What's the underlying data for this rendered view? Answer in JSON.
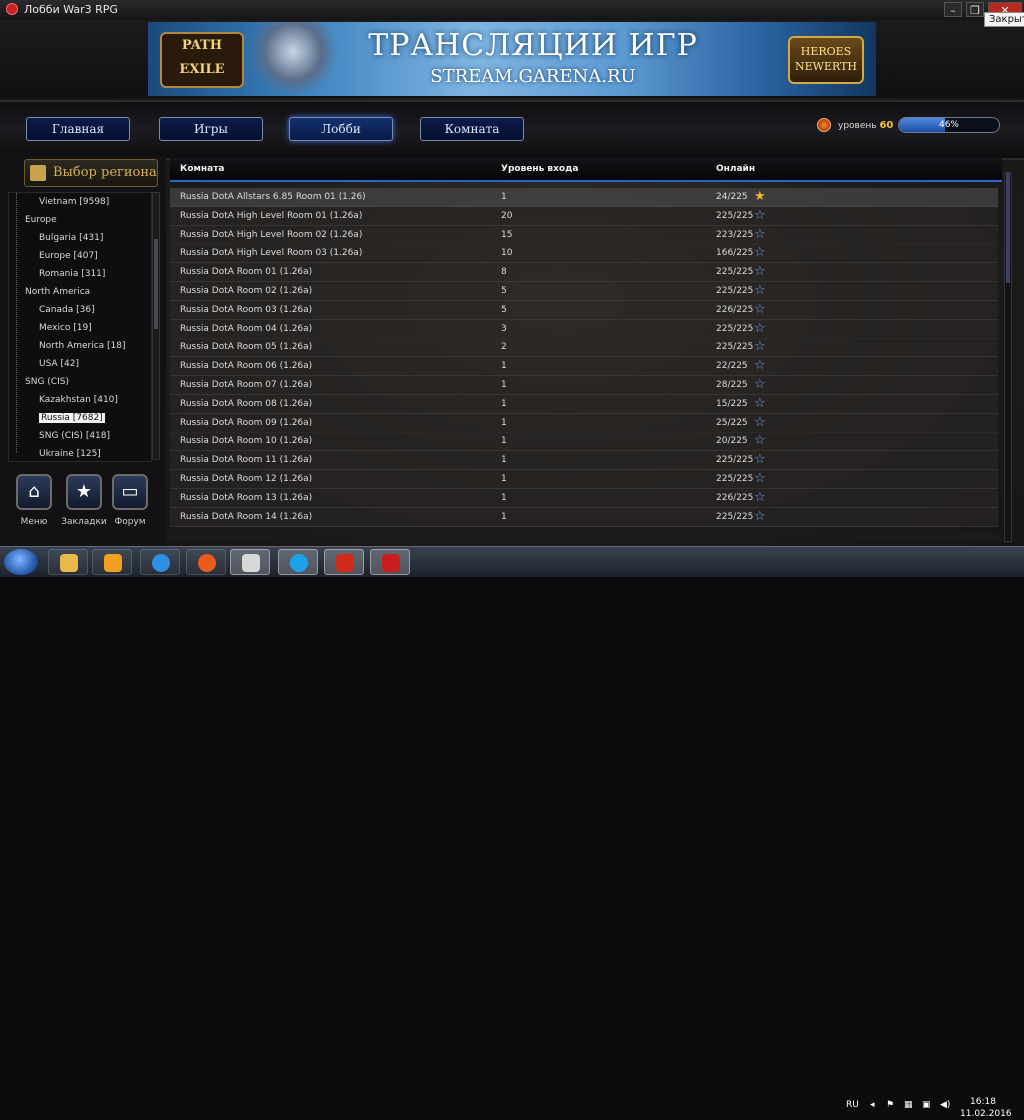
{
  "window": {
    "title": "Лобби War3 RPG",
    "close_tooltip": "Закрыть"
  },
  "banner": {
    "heading": "ТРАНСЛЯЦИИ ИГР",
    "subheading": "STREAM.GARENA.RU",
    "logo_left": "PATH OF EXILE",
    "logo_right": "HEROES OF NEWERTH"
  },
  "nav": {
    "tabs": [
      {
        "label": "Главная",
        "active": false
      },
      {
        "label": "Игры",
        "active": false
      },
      {
        "label": "Лобби",
        "active": true
      },
      {
        "label": "Комната",
        "active": false
      }
    ]
  },
  "level": {
    "label": "уровень",
    "value": "60",
    "progress_text": "46%",
    "progress": 46
  },
  "sidebar": {
    "region_title": "Выбор региона",
    "tree": [
      {
        "label": "Vietnam [9598]",
        "depth": 1,
        "selected": false
      },
      {
        "label": "Europe",
        "depth": 0,
        "selected": false
      },
      {
        "label": "Bulgaria [431]",
        "depth": 1,
        "selected": false
      },
      {
        "label": "Europe [407]",
        "depth": 1,
        "selected": false
      },
      {
        "label": "Romania [311]",
        "depth": 1,
        "selected": false
      },
      {
        "label": "North America",
        "depth": 0,
        "selected": false
      },
      {
        "label": "Canada [36]",
        "depth": 1,
        "selected": false
      },
      {
        "label": "Mexico [19]",
        "depth": 1,
        "selected": false
      },
      {
        "label": "North America [18]",
        "depth": 1,
        "selected": false
      },
      {
        "label": "USA [42]",
        "depth": 1,
        "selected": false
      },
      {
        "label": "SNG (CIS)",
        "depth": 0,
        "selected": false
      },
      {
        "label": "Kazakhstan [410]",
        "depth": 1,
        "selected": false
      },
      {
        "label": "Russia [7682]",
        "depth": 1,
        "selected": true
      },
      {
        "label": "SNG (CIS) [418]",
        "depth": 1,
        "selected": false
      },
      {
        "label": "Ukraine [125]",
        "depth": 1,
        "selected": false
      }
    ],
    "buttons": [
      {
        "label": "Меню",
        "icon": "home-icon"
      },
      {
        "label": "Закладки",
        "icon": "star-icon"
      },
      {
        "label": "Форум",
        "icon": "monitor-icon"
      }
    ]
  },
  "rooms": {
    "columns": [
      "Комната",
      "Уровень входа",
      "Онлайн"
    ],
    "rows": [
      {
        "name": "Russia DotA Allstars 6.85 Room 01 (1.26)",
        "level": "1",
        "online": "24/225",
        "favorite": true
      },
      {
        "name": "Russia DotA High Level Room 01 (1.26a)",
        "level": "20",
        "online": "225/225",
        "favorite": false
      },
      {
        "name": "Russia DotA High Level Room 02 (1.26a)",
        "level": "15",
        "online": "223/225",
        "favorite": false
      },
      {
        "name": "Russia DotA High Level Room 03 (1.26a)",
        "level": "10",
        "online": "166/225",
        "favorite": false
      },
      {
        "name": "Russia DotA Room 01 (1.26a)",
        "level": "8",
        "online": "225/225",
        "favorite": false
      },
      {
        "name": "Russia DotA Room 02 (1.26a)",
        "level": "5",
        "online": "225/225",
        "favorite": false
      },
      {
        "name": "Russia DotA Room 03 (1.26a)",
        "level": "5",
        "online": "226/225",
        "favorite": false
      },
      {
        "name": "Russia DotA Room 04 (1.26a)",
        "level": "3",
        "online": "225/225",
        "favorite": false
      },
      {
        "name": "Russia DotA Room 05 (1.26a)",
        "level": "2",
        "online": "225/225",
        "favorite": false
      },
      {
        "name": "Russia DotA Room 06 (1.26a)",
        "level": "1",
        "online": "22/225",
        "favorite": false
      },
      {
        "name": "Russia DotA Room 07 (1.26a)",
        "level": "1",
        "online": "28/225",
        "favorite": false
      },
      {
        "name": "Russia DotA Room 08 (1.26a)",
        "level": "1",
        "online": "15/225",
        "favorite": false
      },
      {
        "name": "Russia DotA Room 09 (1.26a)",
        "level": "1",
        "online": "25/225",
        "favorite": false
      },
      {
        "name": "Russia DotA Room 10 (1.26a)",
        "level": "1",
        "online": "20/225",
        "favorite": false
      },
      {
        "name": "Russia DotA Room 11 (1.26a)",
        "level": "1",
        "online": "225/225",
        "favorite": false
      },
      {
        "name": "Russia DotA Room 12 (1.26a)",
        "level": "1",
        "online": "225/225",
        "favorite": false
      },
      {
        "name": "Russia DotA Room 13 (1.26a)",
        "level": "1",
        "online": "226/225",
        "favorite": false
      },
      {
        "name": "Russia DotA Room 14 (1.26a)",
        "level": "1",
        "online": "225/225",
        "favorite": false
      }
    ]
  },
  "taskbar": {
    "apps": [
      "folder-icon",
      "media-player-icon",
      "internet-explorer-icon",
      "firefox-icon",
      "garena-icon",
      "skype-icon",
      "garena-talk-icon",
      "garena-plus-icon"
    ],
    "language": "RU",
    "time": "16:18",
    "date": "11.02.2016"
  },
  "colors": {
    "accent": "#2a64c8",
    "favorite_star": "#f2b71c",
    "star": "#6d9ef2"
  }
}
